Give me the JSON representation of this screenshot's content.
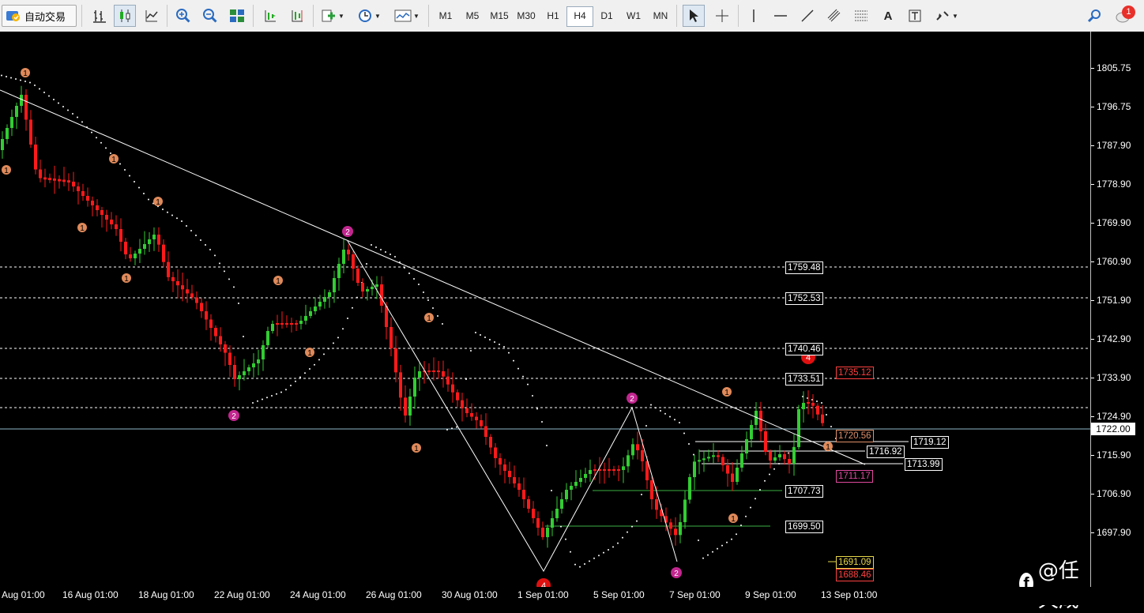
{
  "toolbar": {
    "auto_trade_label": "自动交易",
    "timeframes": [
      "M1",
      "M5",
      "M15",
      "M30",
      "H1",
      "H4",
      "D1",
      "W1",
      "MN"
    ],
    "active_timeframe": "H4",
    "notification_count": "1"
  },
  "price_axis": {
    "ticks": [
      "1805.75",
      "1796.75",
      "1787.90",
      "1778.90",
      "1769.90",
      "1760.90",
      "1751.90",
      "1742.90",
      "1733.90",
      "1724.90",
      "1715.90",
      "1706.90",
      "1697.90"
    ],
    "current_price": "1722.00"
  },
  "time_axis": {
    "labels": [
      "Aug 01:00",
      "16 Aug 01:00",
      "18 Aug 01:00",
      "22 Aug 01:00",
      "24 Aug 01:00",
      "26 Aug 01:00",
      "30 Aug 01:00",
      "1 Sep 01:00",
      "5 Sep 01:00",
      "7 Sep 01:00",
      "9 Sep 01:00",
      "13 Sep 01:00"
    ]
  },
  "levels": {
    "l1759": "1759.48",
    "l1752": "1752.53",
    "l1740": "1740.46",
    "l1733": "1733.51",
    "l1735": "1735.12",
    "l1720": "1720.56",
    "l1719": "1719.12",
    "l1716": "1716.92",
    "l1713": "1713.99",
    "l1711": "1711.17",
    "l1707": "1707.73",
    "l1699": "1699.50",
    "l1691": "1691.09",
    "l1688": "1688.46"
  },
  "markers": {
    "one": "1",
    "two": "2",
    "four": "4"
  },
  "watermark": {
    "fb_letter": "f",
    "text": "@任天成"
  },
  "colors": {
    "bull": "#32cd32",
    "bear": "#ff1a1a",
    "marker_one": "#e08a5a",
    "marker_two": "#c2268f",
    "marker_four": "#e01010"
  }
}
